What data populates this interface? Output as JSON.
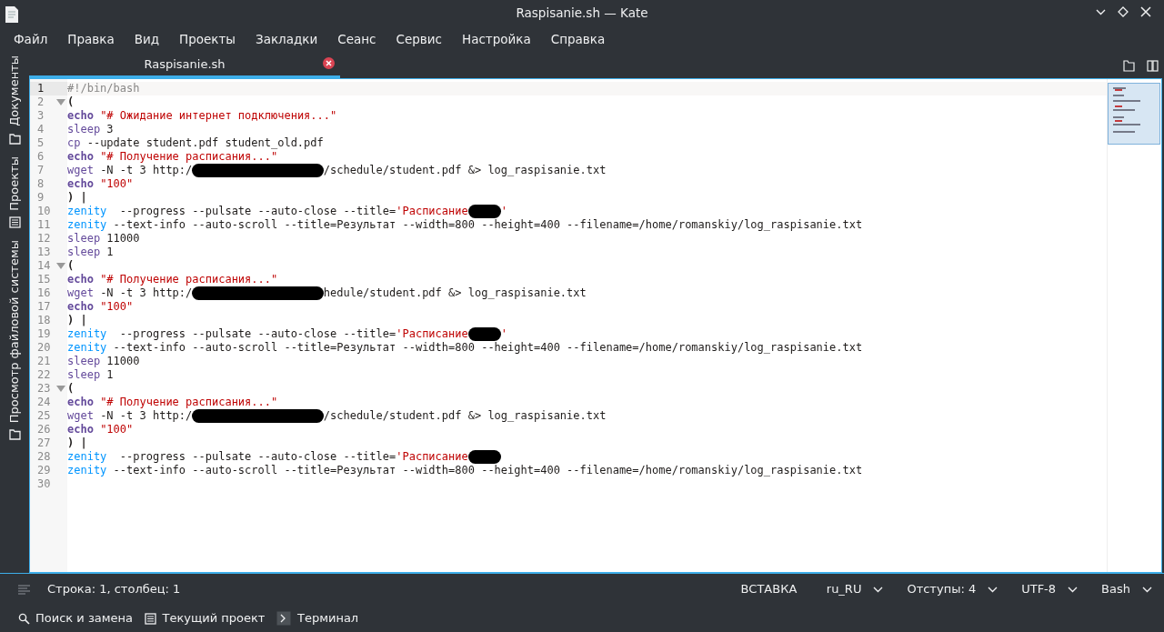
{
  "window": {
    "title": "Raspisanie.sh — Kate"
  },
  "menu": [
    "Файл",
    "Правка",
    "Вид",
    "Проекты",
    "Закладки",
    "Сеанс",
    "Сервис",
    "Настройка",
    "Справка"
  ],
  "side_tabs": [
    {
      "label": "Документы"
    },
    {
      "label": "Проекты"
    },
    {
      "label": "Просмотр файловой системы"
    }
  ],
  "tabs": [
    {
      "label": "Raspisanie.sh",
      "selected": true
    }
  ],
  "lines": [
    {
      "num": "1",
      "current": true,
      "tokens": [
        {
          "kind": "comment",
          "text": "#!/bin/bash"
        }
      ]
    },
    {
      "num": "2",
      "fold": true,
      "tokens": [
        {
          "kind": "bracket",
          "text": "("
        }
      ]
    },
    {
      "num": "3",
      "tokens": [
        {
          "kind": "keyword",
          "text": "echo"
        },
        {
          "kind": "string",
          "text": "\"# Ожидание интернет подключения...\""
        }
      ]
    },
    {
      "num": "4",
      "tokens": [
        {
          "kind": "builtin",
          "text": "sleep"
        },
        {
          "kind": "plain",
          "text": " 3"
        }
      ]
    },
    {
      "num": "5",
      "tokens": [
        {
          "kind": "builtin",
          "text": "cp"
        },
        {
          "kind": "plain",
          "text": " --update student.pdf student_old.pdf"
        }
      ]
    },
    {
      "num": "6",
      "tokens": [
        {
          "kind": "keyword",
          "text": "echo"
        },
        {
          "kind": "string",
          "text": "\"# Получение расписания...\""
        }
      ]
    },
    {
      "num": "7",
      "tokens": [
        {
          "kind": "builtin",
          "text": "wget"
        },
        {
          "kind": "plain",
          "text": " -N -t 3 http:/"
        },
        {
          "kind": "redaction"
        },
        {
          "kind": "plain",
          "text": "/schedule/student.pdf &> log_raspisanie.txt"
        }
      ]
    },
    {
      "num": "8",
      "tokens": [
        {
          "kind": "keyword",
          "text": "echo"
        },
        {
          "kind": "string",
          "text": "\"100\""
        }
      ]
    },
    {
      "num": "9",
      "tokens": [
        {
          "kind": "bracket",
          "text": ") |"
        }
      ]
    },
    {
      "num": "10",
      "tokens": [
        {
          "kind": "command",
          "text": "zenity"
        },
        {
          "kind": "plain",
          "text": "  --progress --pulsate --auto-close --title="
        },
        {
          "kind": "string",
          "text": "'Расписание"
        },
        {
          "kind": "redaction"
        },
        {
          "kind": "string",
          "text": "'"
        }
      ]
    },
    {
      "num": "11",
      "tokens": [
        {
          "kind": "command",
          "text": "zenity"
        },
        {
          "kind": "plain",
          "text": " --text-info --auto-scroll --title=Результат --width=800 --height=400 --filename=/home/romanskiy/log_raspisanie.txt"
        }
      ]
    },
    {
      "num": "12",
      "tokens": [
        {
          "kind": "builtin",
          "text": "sleep"
        },
        {
          "kind": "plain",
          "text": " 11000"
        }
      ]
    },
    {
      "num": "13",
      "tokens": [
        {
          "kind": "builtin",
          "text": "sleep"
        },
        {
          "kind": "plain",
          "text": " 1"
        }
      ]
    },
    {
      "num": "14",
      "fold": true,
      "tokens": [
        {
          "kind": "bracket",
          "text": "("
        }
      ]
    },
    {
      "num": "15",
      "tokens": [
        {
          "kind": "keyword",
          "text": "echo"
        },
        {
          "kind": "string",
          "text": "\"# Получение расписания...\""
        }
      ]
    },
    {
      "num": "16",
      "tokens": [
        {
          "kind": "builtin",
          "text": "wget"
        },
        {
          "kind": "plain",
          "text": " -N -t 3 http:/"
        },
        {
          "kind": "redaction"
        },
        {
          "kind": "plain",
          "text": "hedule/student.pdf &> log_raspisanie.txt"
        }
      ]
    },
    {
      "num": "17",
      "tokens": [
        {
          "kind": "keyword",
          "text": "echo"
        },
        {
          "kind": "string",
          "text": "\"100\""
        }
      ]
    },
    {
      "num": "18",
      "tokens": [
        {
          "kind": "bracket",
          "text": ") |"
        }
      ]
    },
    {
      "num": "19",
      "tokens": [
        {
          "kind": "command",
          "text": "zenity"
        },
        {
          "kind": "plain",
          "text": "  --progress --pulsate --auto-close --title="
        },
        {
          "kind": "string",
          "text": "'Расписание"
        },
        {
          "kind": "redaction"
        },
        {
          "kind": "string",
          "text": "'"
        }
      ]
    },
    {
      "num": "20",
      "tokens": [
        {
          "kind": "command",
          "text": "zenity"
        },
        {
          "kind": "plain",
          "text": " --text-info --auto-scroll --title=Результат --width=800 --height=400 --filename=/home/romanskiy/log_raspisanie.txt"
        }
      ]
    },
    {
      "num": "21",
      "tokens": [
        {
          "kind": "builtin",
          "text": "sleep"
        },
        {
          "kind": "plain",
          "text": " 11000"
        }
      ]
    },
    {
      "num": "22",
      "tokens": [
        {
          "kind": "builtin",
          "text": "sleep"
        },
        {
          "kind": "plain",
          "text": " 1"
        }
      ]
    },
    {
      "num": "23",
      "fold": true,
      "tokens": [
        {
          "kind": "bracket",
          "text": "("
        }
      ]
    },
    {
      "num": "24",
      "tokens": [
        {
          "kind": "keyword",
          "text": "echo"
        },
        {
          "kind": "string",
          "text": "\"# Получение расписания...\""
        }
      ]
    },
    {
      "num": "25",
      "tokens": [
        {
          "kind": "builtin",
          "text": "wget"
        },
        {
          "kind": "plain",
          "text": " -N -t 3 http:/"
        },
        {
          "kind": "redaction"
        },
        {
          "kind": "plain",
          "text": "/schedule/student.pdf &> log_raspisanie.txt"
        }
      ]
    },
    {
      "num": "26",
      "tokens": [
        {
          "kind": "keyword",
          "text": "echo"
        },
        {
          "kind": "string",
          "text": "\"100\""
        }
      ]
    },
    {
      "num": "27",
      "tokens": [
        {
          "kind": "bracket",
          "text": ") |"
        }
      ]
    },
    {
      "num": "28",
      "tokens": [
        {
          "kind": "command",
          "text": "zenity"
        },
        {
          "kind": "plain",
          "text": "  --progress --pulsate --auto-close --title="
        },
        {
          "kind": "string",
          "text": "'Расписание"
        },
        {
          "kind": "redaction"
        }
      ]
    },
    {
      "num": "29",
      "tokens": [
        {
          "kind": "command",
          "text": "zenity"
        },
        {
          "kind": "plain",
          "text": " --text-info --auto-scroll --title=Результат --width=800 --height=400 --filename=/home/romanskiy/log_raspisanie.txt"
        }
      ]
    },
    {
      "num": "30"
    }
  ],
  "status_bar": {
    "position": "Строка: 1, столбец: 1",
    "mode": "ВСТАВКА",
    "dropdowns": [
      "ru_RU",
      "Отступы: 4",
      "UTF-8",
      "Bash"
    ]
  },
  "tool_views": [
    {
      "label": "Поиск и замена"
    },
    {
      "label": "Текущий проект"
    },
    {
      "label": "Терминал"
    }
  ]
}
